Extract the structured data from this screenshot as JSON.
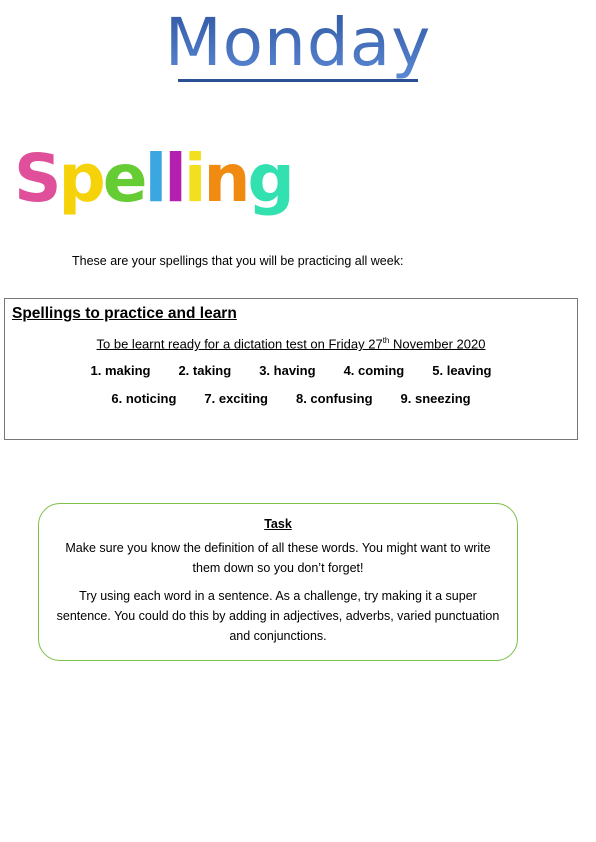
{
  "title": "Monday",
  "logo": {
    "text": "Spelling",
    "letters": [
      {
        "c": "S",
        "color": "#e0509a"
      },
      {
        "c": "p",
        "color": "#f5d20a"
      },
      {
        "c": "e",
        "color": "#66cc33"
      },
      {
        "c": "l",
        "color": "#3aa7e0"
      },
      {
        "c": "l",
        "color": "#b41fb0"
      },
      {
        "c": "i",
        "color": "#f2e020"
      },
      {
        "c": "n",
        "color": "#f08a10"
      },
      {
        "c": "g",
        "color": "#33e0b0"
      }
    ]
  },
  "intro": "These are your spellings that you will be practicing all week:",
  "spellings": {
    "heading": "Spellings to practice and learn",
    "subtitle_pre": "To be learnt ready for a dictation test on Friday 27",
    "subtitle_sup": "th",
    "subtitle_post": " November 2020",
    "row1": [
      "1. making",
      "2. taking",
      "3.   having",
      "4.   coming",
      "5. leaving"
    ],
    "row2": [
      "6. noticing",
      "7. exciting",
      "8. confusing",
      "9. sneezing"
    ]
  },
  "task": {
    "heading": "Task",
    "p1": "Make sure you know the definition of all these words. You might want to write them down so you don’t forget!",
    "p2": "Try using each word in a sentence. As a challenge, try making it a super sentence. You could do this by adding in adjectives, adverbs, varied punctuation and conjunctions."
  }
}
